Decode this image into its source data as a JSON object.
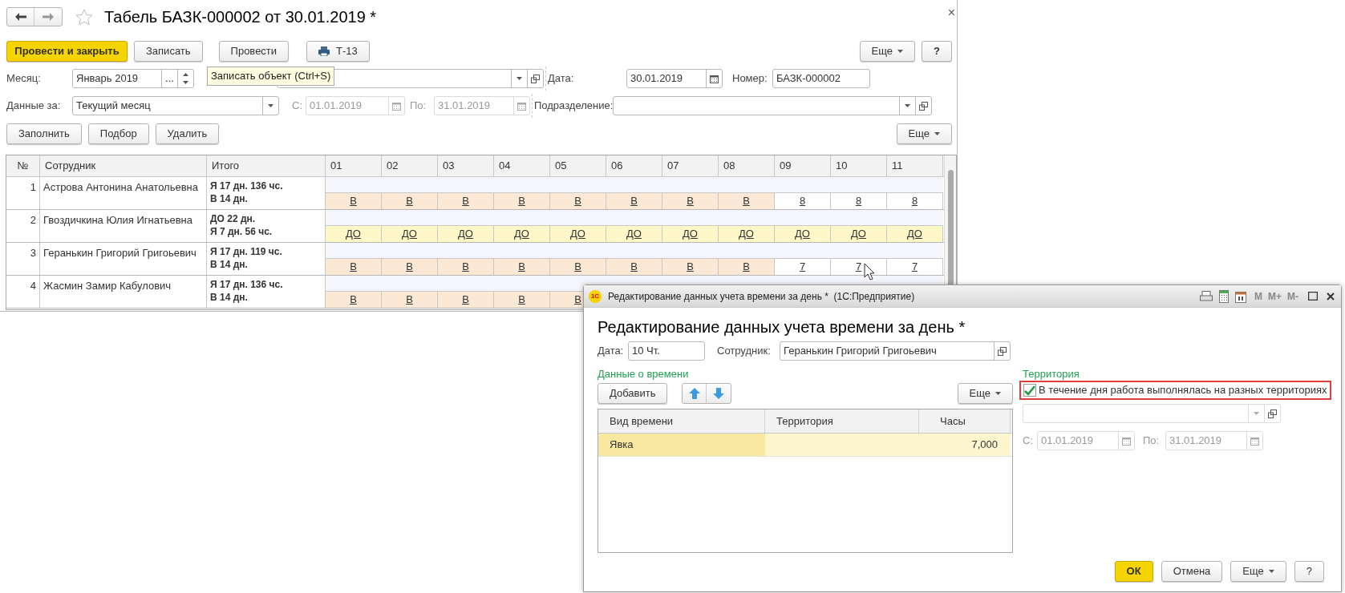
{
  "window": {
    "title": "Табель БАЗК-000002 от 30.01.2019 *",
    "close": "×"
  },
  "toolbar": {
    "buttons": [
      {
        "label": "Провести и закрыть",
        "kind": "primary"
      },
      {
        "label": "Записать",
        "kind": "normal"
      },
      {
        "label": "Провести",
        "kind": "normal"
      },
      {
        "label": "Т-13",
        "kind": "print"
      }
    ],
    "more": "Еще",
    "help": "?"
  },
  "tooltip": "Записать объект (Ctrl+S)",
  "header_fields": {
    "month_label": "Месяц:",
    "month_value": "Январь 2019",
    "month_dots": "...",
    "date_label": "Дата:",
    "date_value": "30.01.2019",
    "number_label": "Номер:",
    "number_value": "БАЗК-000002",
    "period_label": "Данные за:",
    "period_value": "Текущий месяц",
    "from_label": "С:",
    "from_value": "01.01.2019",
    "to_label": "По:",
    "to_value": "31.01.2019",
    "period_dates_disabled": true,
    "dept_label": "Подразделение:"
  },
  "table_buttons": [
    {
      "label": "Заполнить"
    },
    {
      "label": "Подбор"
    },
    {
      "label": "Удалить"
    }
  ],
  "table_more": "Еще",
  "table": {
    "columns": [
      "№",
      "Сотрудник",
      "Итого"
    ],
    "days": [
      "01",
      "02",
      "03",
      "04",
      "05",
      "06",
      "07",
      "08",
      "09",
      "10",
      "11"
    ],
    "rows": [
      {
        "number": "1",
        "employee": "Астрова Антонина Анатольевна",
        "totals": [
          "Я 17 дн. 136 чс.",
          "В 14 дн."
        ],
        "days": [
          {
            "code": "В",
            "kind": "weekend"
          },
          {
            "code": "В",
            "kind": "weekend"
          },
          {
            "code": "В",
            "kind": "weekend"
          },
          {
            "code": "В",
            "kind": "weekend"
          },
          {
            "code": "В",
            "kind": "weekend"
          },
          {
            "code": "В",
            "kind": "weekend"
          },
          {
            "code": "В",
            "kind": "weekend"
          },
          {
            "code": "В",
            "kind": "weekend"
          },
          {
            "code": "8",
            "kind": "work"
          },
          {
            "code": "8",
            "kind": "work"
          },
          {
            "code": "8",
            "kind": "work"
          }
        ]
      },
      {
        "number": "2",
        "employee": "Гвоздичкина Юлия Игнатьевна",
        "totals": [
          "ДО 22 дн.",
          "Я 7 дн. 56 чс."
        ],
        "days": [
          {
            "code": "ДО",
            "kind": "absence"
          },
          {
            "code": "ДО",
            "kind": "absence"
          },
          {
            "code": "ДО",
            "kind": "absence"
          },
          {
            "code": "ДО",
            "kind": "absence"
          },
          {
            "code": "ДО",
            "kind": "absence"
          },
          {
            "code": "ДО",
            "kind": "absence"
          },
          {
            "code": "ДО",
            "kind": "absence"
          },
          {
            "code": "ДО",
            "kind": "absence"
          },
          {
            "code": "ДО",
            "kind": "absence"
          },
          {
            "code": "ДО",
            "kind": "absence"
          },
          {
            "code": "ДО",
            "kind": "absence"
          }
        ]
      },
      {
        "number": "3",
        "employee": "Геранькин Григорий Григоьевич",
        "totals": [
          "Я 17 дн. 119 чс.",
          "В 14 дн."
        ],
        "days": [
          {
            "code": "В",
            "kind": "weekend"
          },
          {
            "code": "В",
            "kind": "weekend"
          },
          {
            "code": "В",
            "kind": "weekend"
          },
          {
            "code": "В",
            "kind": "weekend"
          },
          {
            "code": "В",
            "kind": "weekend"
          },
          {
            "code": "В",
            "kind": "weekend"
          },
          {
            "code": "В",
            "kind": "weekend"
          },
          {
            "code": "В",
            "kind": "weekend"
          },
          {
            "code": "7",
            "kind": "work"
          },
          {
            "code": "7",
            "kind": "work"
          },
          {
            "code": "7",
            "kind": "work"
          }
        ]
      },
      {
        "number": "4",
        "employee": "Жасмин Замир Кабулович",
        "totals": [
          "Я 17 дн. 136 чс.",
          "В 14 дн."
        ],
        "days": [
          {
            "code": "В",
            "kind": "weekend"
          },
          {
            "code": "В",
            "kind": "weekend"
          },
          {
            "code": "В",
            "kind": "weekend"
          },
          {
            "code": "В",
            "kind": "weekend"
          },
          {
            "code": "В",
            "kind": "weekend"
          }
        ]
      }
    ]
  },
  "dialog": {
    "logo": "1С",
    "caption": "Редактирование данных учета времени за день *  (1С:Предприятие)",
    "memory_buttons": [
      "M",
      "M+",
      "M-"
    ],
    "heading": "Редактирование данных учета времени за день *",
    "date_label": "Дата:",
    "date_value": "10 Чт.",
    "employee_label": "Сотрудник:",
    "employee_value": "Геранькин Григорий Григоьевич",
    "time_group": "Данные о времени",
    "add_button": "Добавить",
    "more_button": "Еще",
    "table": {
      "columns": [
        "Вид времени",
        "Территория",
        "Часы"
      ],
      "rows": [
        {
          "time_type": "Явка",
          "hours": "7,000",
          "selected": true
        }
      ]
    },
    "territory_group": "Территория",
    "multi_territory": {
      "label": "В течение дня работа выполнялась на разных территориях",
      "checked": true,
      "highlighted": true
    },
    "from_label": "С:",
    "from_value": "01.01.2019",
    "to_label": "По:",
    "to_value": "31.01.2019",
    "dates_disabled": true,
    "footer_buttons": [
      {
        "label": "ОК",
        "kind": "primary"
      },
      {
        "label": "Отмена",
        "kind": "normal"
      },
      {
        "label": "Еще",
        "kind": "menu"
      },
      {
        "label": "?",
        "kind": "normal"
      }
    ]
  }
}
